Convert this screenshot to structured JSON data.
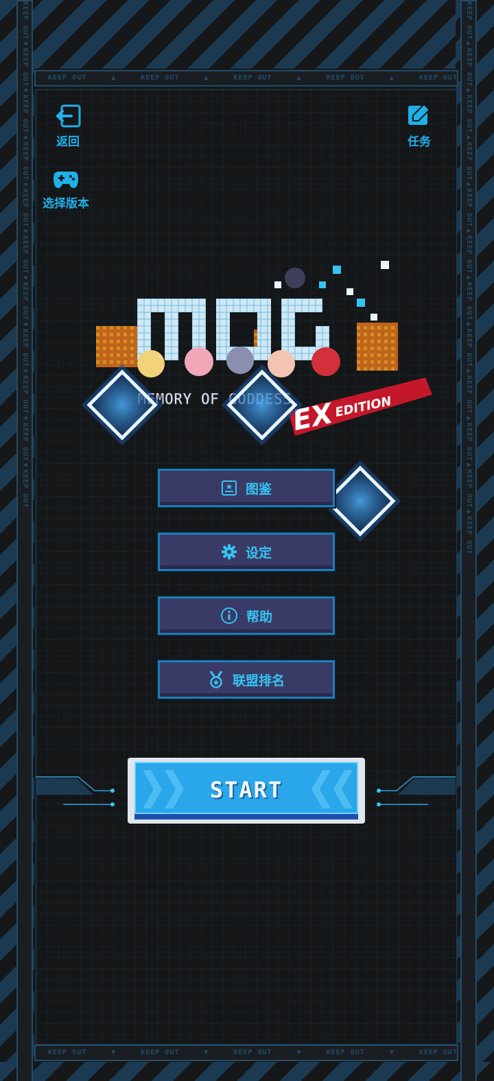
{
  "nav": {
    "back_label": "返回",
    "tasks_label": "任务",
    "version_label": "选择版本"
  },
  "logo": {
    "title": "MOG",
    "subtitle": "MEMORY OF GODDESS",
    "edition_ex": "EX",
    "edition_word": "EDITION"
  },
  "menu": {
    "items": [
      {
        "label": "图鉴",
        "icon": "card-icon"
      },
      {
        "label": "设定",
        "icon": "gear-icon"
      },
      {
        "label": "帮助",
        "icon": "info-icon"
      },
      {
        "label": "联盟排名",
        "icon": "medal-icon"
      }
    ]
  },
  "start": {
    "label": "START"
  },
  "tape_text": "KEEP OUT",
  "colors": {
    "accent": "#1fb0e8",
    "button_bg": "#3a3a66",
    "start_bg": "#2aa6ea",
    "stripe": "#1b3a52"
  }
}
